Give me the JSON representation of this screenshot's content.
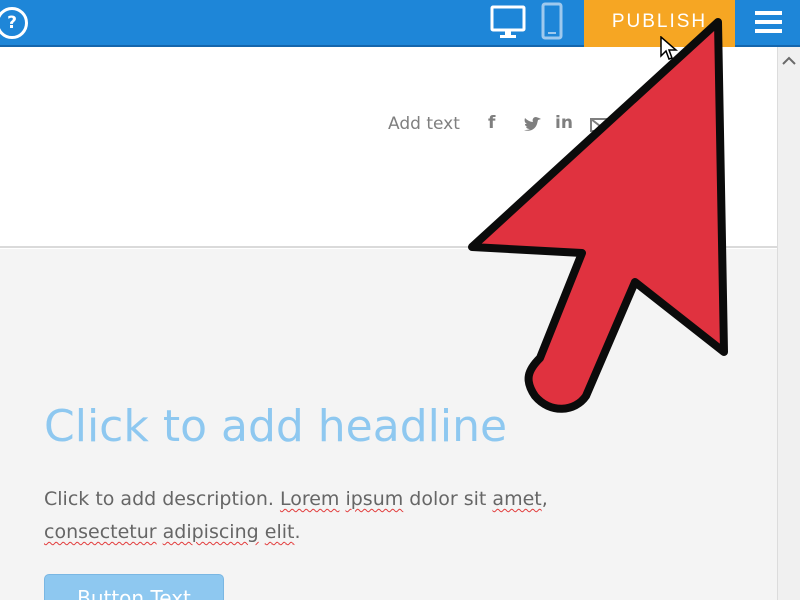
{
  "toolbar": {
    "help_icon": "help-icon",
    "help_glyph": "?",
    "desktop_icon": "desktop-icon",
    "mobile_icon": "mobile-icon",
    "publish_label": "PUBLISH",
    "menu_icon": "menu-icon",
    "colors": {
      "bar": "#1e86d8",
      "publish": "#f6a623"
    }
  },
  "header": {
    "add_text": "Add text",
    "social_icons": [
      "facebook-icon",
      "twitter-icon",
      "linkedin-icon",
      "email-icon"
    ],
    "facebook_glyph": "f",
    "linkedin_glyph": "in"
  },
  "hero": {
    "headline": "Click to add headline",
    "description_parts": {
      "p1": "Click to add description. ",
      "lorem": "Lorem",
      "s1": " ",
      "ipsum": "ipsum",
      "p2": " dolor sit ",
      "amet": "amet",
      "p3": ",",
      "consectetur": "consectetur",
      "s2": " ",
      "adipiscing": "adipiscing",
      "s3": " ",
      "elit": "elit",
      "p4": "."
    },
    "button_label": "Button Text",
    "colors": {
      "headline": "#8ec8f0",
      "background": "#f4f4f4"
    }
  },
  "overlay": {
    "icon": "red-arrow-pointer-icon",
    "color": "#e0323f"
  }
}
